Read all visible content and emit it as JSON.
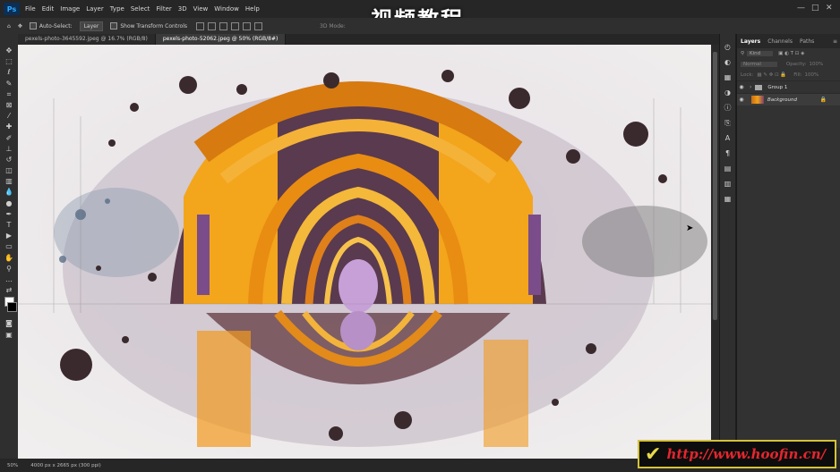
{
  "menu": {
    "app_icon": "Ps",
    "items": [
      "File",
      "Edit",
      "Image",
      "Layer",
      "Type",
      "Select",
      "Filter",
      "3D",
      "View",
      "Window",
      "Help"
    ]
  },
  "video_title": "视频教程",
  "options": {
    "auto_select_label": "Auto-Select:",
    "auto_select_value": "Layer",
    "show_transform_label": "Show Transform Controls",
    "mode_3d_label": "3D Mode:"
  },
  "tabs": [
    {
      "label": "pexels-photo-3645592.jpeg @ 16.7% (RGB/8)"
    },
    {
      "label": "pexels-photo-52062.jpeg @ 50% (RGB/8#)"
    }
  ],
  "panel": {
    "tabs": [
      "Layers",
      "Channels",
      "Paths"
    ],
    "kind_label": "Kind",
    "blend_label": "Normal",
    "opacity_label": "Opacity:",
    "opacity_value": "100%",
    "lock_label": "Lock:",
    "fill_label": "Fill:",
    "fill_value": "100%",
    "layers": [
      {
        "name": "Group 1",
        "type": "group"
      },
      {
        "name": "Background",
        "type": "image",
        "locked": true
      }
    ]
  },
  "status": {
    "zoom": "50%",
    "doc_info": "4000 px x 2665 px (300 ppi)"
  },
  "watermark": {
    "url": "http://www.hoofin.cn/"
  },
  "colors": {
    "accent": "#31a8ff",
    "watermark_border": "#d5c23a",
    "watermark_text": "#e3262e"
  }
}
